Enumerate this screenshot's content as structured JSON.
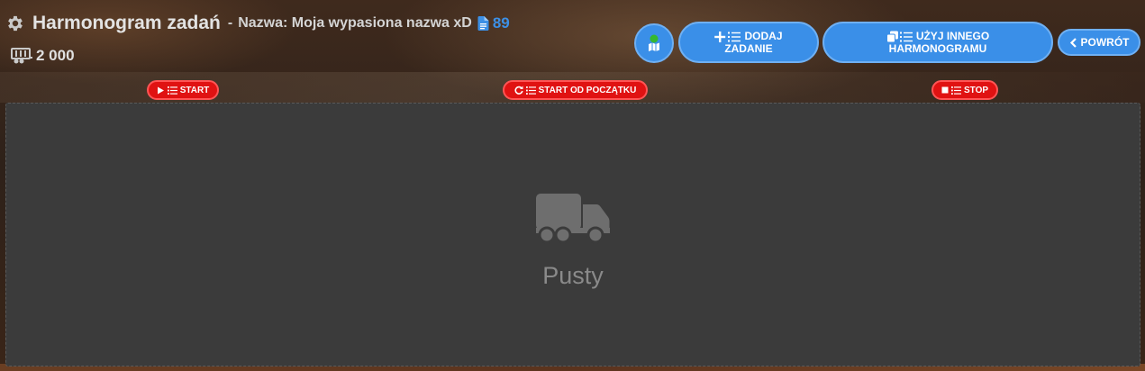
{
  "header": {
    "title": "Harmonogram zadań",
    "separator": "-",
    "name_label": "Nazwa: Moja wypasiona nazwa xD",
    "count": "89",
    "capacity": "2 000",
    "icons": {
      "settings": "gear-icon",
      "document": "document-icon",
      "trailer": "trailer-icon"
    }
  },
  "toolbar": {
    "add_task_line1": "DODAJ",
    "add_task_line2": "ZADANIE",
    "use_other_line1": "UŻYJ INNEGO",
    "use_other_line2": "HARMONOGRAMU",
    "back": "POWRÓT",
    "accent_color": "#3a8fe8",
    "map_status_color": "#35b830"
  },
  "controls": {
    "start": "START",
    "restart": "START OD POCZĄTKU",
    "stop": "STOP",
    "color": "#e01212"
  },
  "main": {
    "empty_label": "Pusty",
    "empty_icon": "truck-icon"
  }
}
